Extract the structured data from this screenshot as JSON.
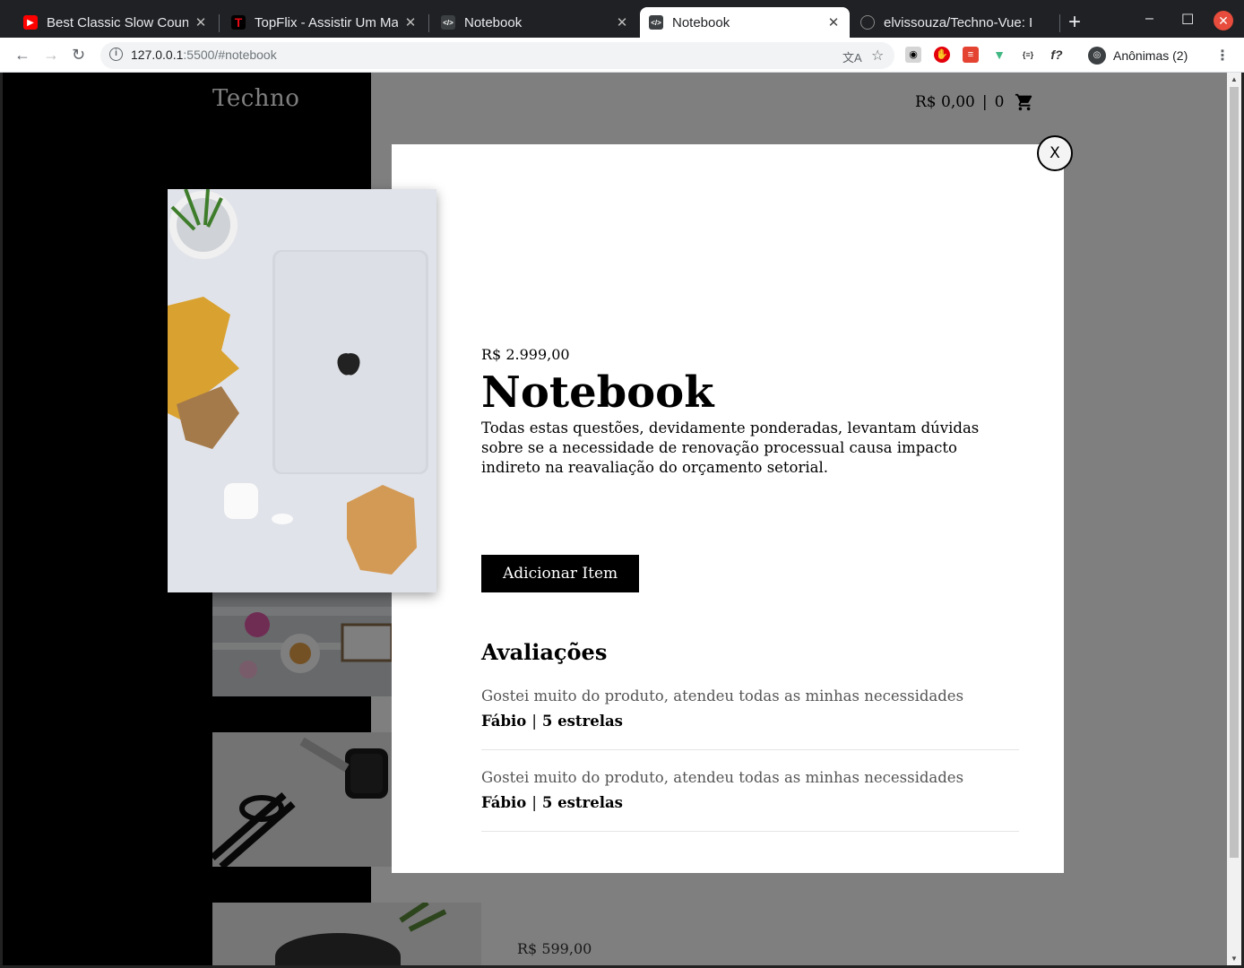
{
  "browser": {
    "tabs": [
      {
        "title": "Best Classic Slow Country",
        "icon": "youtube-icon"
      },
      {
        "title": "TopFlix - Assistir Um Mal",
        "icon": "topflix-icon"
      },
      {
        "title": "Notebook",
        "icon": "vue-code-icon"
      },
      {
        "title": "Notebook",
        "icon": "vue-code-icon",
        "active": true
      },
      {
        "title": "elvissouza/Techno-Vue: I",
        "icon": "github-icon"
      }
    ],
    "url_host": "127.0.0.1",
    "url_rest": ":5500/#notebook",
    "profile_label": "Anônimas (2)"
  },
  "site": {
    "logo": "Techno",
    "cart_total": "R$ 0,00",
    "cart_sep": "|",
    "cart_count": "0",
    "bottom_price": "R$ 599,00"
  },
  "modal": {
    "close_label": "X",
    "price": "R$ 2.999,00",
    "title": "Notebook",
    "description": "Todas estas questões, devidamente ponderadas, levantam dúvidas sobre se a necessidade de renovação processual causa impacto indireto na reavaliação do orçamento setorial.",
    "add_button": "Adicionar Item",
    "reviews_title": "Avaliações",
    "reviews": [
      {
        "text": "Gostei muito do produto, atendeu todas as minhas necessidades",
        "author": "Fábio",
        "sep": "|",
        "rating": "5 estrelas"
      },
      {
        "text": "Gostei muito do produto, atendeu todas as minhas necessidades",
        "author": "Fábio",
        "sep": "|",
        "rating": "5 estrelas"
      }
    ]
  },
  "colors": {
    "accent": "#000000",
    "overlay": "rgba(0,0,0,0.5)"
  }
}
